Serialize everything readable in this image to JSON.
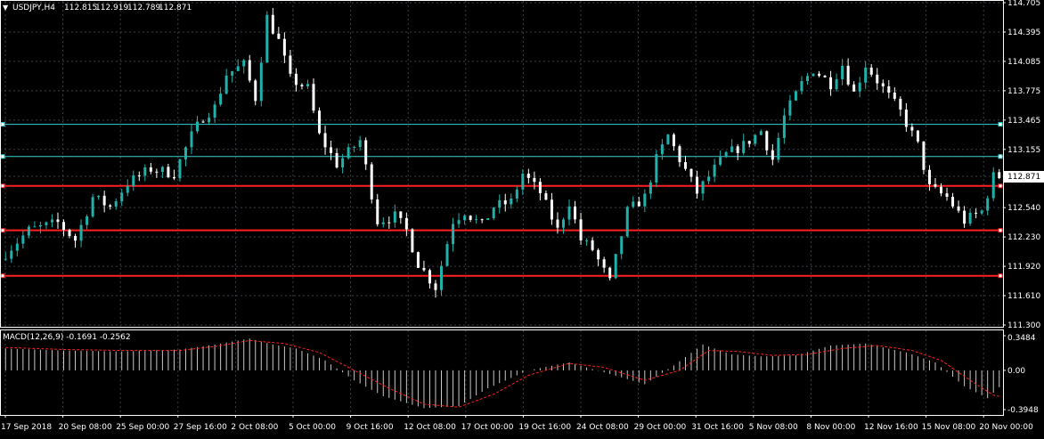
{
  "window": {
    "symbol_title": "USDJPY,H4",
    "ohlc": [
      "112.815",
      "112.919",
      "112.789",
      "112.871"
    ]
  },
  "price_axis": {
    "ticks": [
      "114.705",
      "114.395",
      "114.085",
      "113.775",
      "113.465",
      "113.155",
      "112.871",
      "112.540",
      "112.230",
      "111.920",
      "111.610",
      "111.300"
    ],
    "current_price_label": "112.871",
    "range": [
      111.3,
      114.705
    ]
  },
  "horizontal_lines": [
    {
      "color": "#35d3d3",
      "price": 113.42
    },
    {
      "color": "#35d3d3",
      "price": 113.08
    },
    {
      "color": "#ff2020",
      "price": 112.77
    },
    {
      "color": "#ff2020",
      "price": 112.3
    },
    {
      "color": "#ff2020",
      "price": 111.82
    }
  ],
  "macd": {
    "label": "MACD(12,26,9) -0.1691 -0.2562",
    "ticks": [
      "0.3484",
      "0.00",
      "-0.3948"
    ],
    "range": [
      -0.3948,
      0.3484
    ]
  },
  "time_axis": {
    "labels": [
      "17 Sep 2018",
      "20 Sep 08:00",
      "25 Sep 00:00",
      "27 Sep 16:00",
      "2 Oct 08:00",
      "5 Oct 00:00",
      "9 Oct 16:00",
      "12 Oct 08:00",
      "17 Oct 00:00",
      "19 Oct 16:00",
      "24 Oct 08:00",
      "29 Oct 00:00",
      "31 Oct 16:00",
      "5 Nov 08:00",
      "8 Nov 00:00",
      "12 Nov 16:00",
      "15 Nov 08:00",
      "20 Nov 00:00"
    ]
  },
  "colors": {
    "background": "#000000",
    "bull": "#20b2aa",
    "bear": "#ffffff",
    "grid": "#3a4048",
    "axis_text": "#ffffff",
    "macd_signal": "#ff2020",
    "macd_hist": "#c8c8c8"
  },
  "chart_data": {
    "type": "candlestick",
    "price_path": [
      [
        0,
        112.0
      ],
      [
        5,
        112.3
      ],
      [
        10,
        112.38
      ],
      [
        13,
        112.2
      ],
      [
        16,
        112.65
      ],
      [
        19,
        112.55
      ],
      [
        22,
        112.8
      ],
      [
        26,
        112.95
      ],
      [
        30,
        112.9
      ],
      [
        33,
        113.3
      ],
      [
        35,
        113.5
      ],
      [
        37,
        113.6
      ],
      [
        39,
        113.95
      ],
      [
        42,
        114.05
      ],
      [
        44,
        113.7
      ],
      [
        46,
        114.55
      ],
      [
        48,
        114.3
      ],
      [
        50,
        113.9
      ],
      [
        53,
        113.8
      ],
      [
        55,
        113.3
      ],
      [
        58,
        113.0
      ],
      [
        62,
        113.25
      ],
      [
        65,
        112.4
      ],
      [
        68,
        112.45
      ],
      [
        70,
        112.3
      ],
      [
        72,
        111.95
      ],
      [
        75,
        111.7
      ],
      [
        78,
        112.4
      ],
      [
        80,
        112.5
      ],
      [
        83,
        112.35
      ],
      [
        85,
        112.55
      ],
      [
        88,
        112.6
      ],
      [
        90,
        112.9
      ],
      [
        93,
        112.7
      ],
      [
        96,
        112.3
      ],
      [
        98,
        112.6
      ],
      [
        100,
        112.2
      ],
      [
        102,
        112.1
      ],
      [
        105,
        111.75
      ],
      [
        108,
        112.5
      ],
      [
        111,
        112.65
      ],
      [
        113,
        113.05
      ],
      [
        115,
        113.3
      ],
      [
        117,
        113.05
      ],
      [
        120,
        112.7
      ],
      [
        123,
        112.95
      ],
      [
        125,
        113.1
      ],
      [
        128,
        113.2
      ],
      [
        131,
        113.35
      ],
      [
        133,
        113.05
      ],
      [
        135,
        113.5
      ],
      [
        138,
        113.85
      ],
      [
        140,
        114.0
      ],
      [
        143,
        113.85
      ],
      [
        145,
        114.05
      ],
      [
        147,
        113.75
      ],
      [
        149,
        114.05
      ],
      [
        152,
        113.8
      ],
      [
        155,
        113.55
      ],
      [
        158,
        113.2
      ],
      [
        160,
        112.75
      ],
      [
        163,
        112.65
      ],
      [
        166,
        112.4
      ],
      [
        169,
        112.5
      ],
      [
        171,
        112.87
      ]
    ],
    "macd_path": [
      [
        0,
        0.22
      ],
      [
        10,
        0.2
      ],
      [
        20,
        0.19
      ],
      [
        30,
        0.21
      ],
      [
        36,
        0.26
      ],
      [
        42,
        0.32
      ],
      [
        46,
        0.26
      ],
      [
        50,
        0.22
      ],
      [
        55,
        0.1
      ],
      [
        60,
        -0.1
      ],
      [
        65,
        -0.26
      ],
      [
        72,
        -0.38
      ],
      [
        78,
        -0.36
      ],
      [
        83,
        -0.18
      ],
      [
        90,
        0.0
      ],
      [
        97,
        0.08
      ],
      [
        103,
        -0.02
      ],
      [
        110,
        -0.14
      ],
      [
        115,
        0.05
      ],
      [
        120,
        0.26
      ],
      [
        125,
        0.16
      ],
      [
        130,
        0.14
      ],
      [
        136,
        0.15
      ],
      [
        142,
        0.25
      ],
      [
        148,
        0.27
      ],
      [
        155,
        0.18
      ],
      [
        160,
        0.08
      ],
      [
        165,
        -0.16
      ],
      [
        169,
        -0.28
      ],
      [
        171,
        -0.17
      ]
    ],
    "signal_path": [
      [
        0,
        0.23
      ],
      [
        10,
        0.21
      ],
      [
        20,
        0.2
      ],
      [
        30,
        0.2
      ],
      [
        36,
        0.24
      ],
      [
        42,
        0.3
      ],
      [
        48,
        0.27
      ],
      [
        54,
        0.18
      ],
      [
        60,
        0.0
      ],
      [
        66,
        -0.18
      ],
      [
        72,
        -0.34
      ],
      [
        78,
        -0.37
      ],
      [
        84,
        -0.24
      ],
      [
        90,
        -0.05
      ],
      [
        97,
        0.07
      ],
      [
        103,
        0.03
      ],
      [
        110,
        -0.1
      ],
      [
        116,
        0.0
      ],
      [
        121,
        0.2
      ],
      [
        126,
        0.19
      ],
      [
        132,
        0.15
      ],
      [
        138,
        0.16
      ],
      [
        144,
        0.22
      ],
      [
        150,
        0.25
      ],
      [
        156,
        0.2
      ],
      [
        161,
        0.1
      ],
      [
        166,
        -0.1
      ],
      [
        170,
        -0.25
      ],
      [
        171,
        -0.26
      ]
    ],
    "candle_count": 172,
    "ylim": [
      111.3,
      114.705
    ]
  }
}
